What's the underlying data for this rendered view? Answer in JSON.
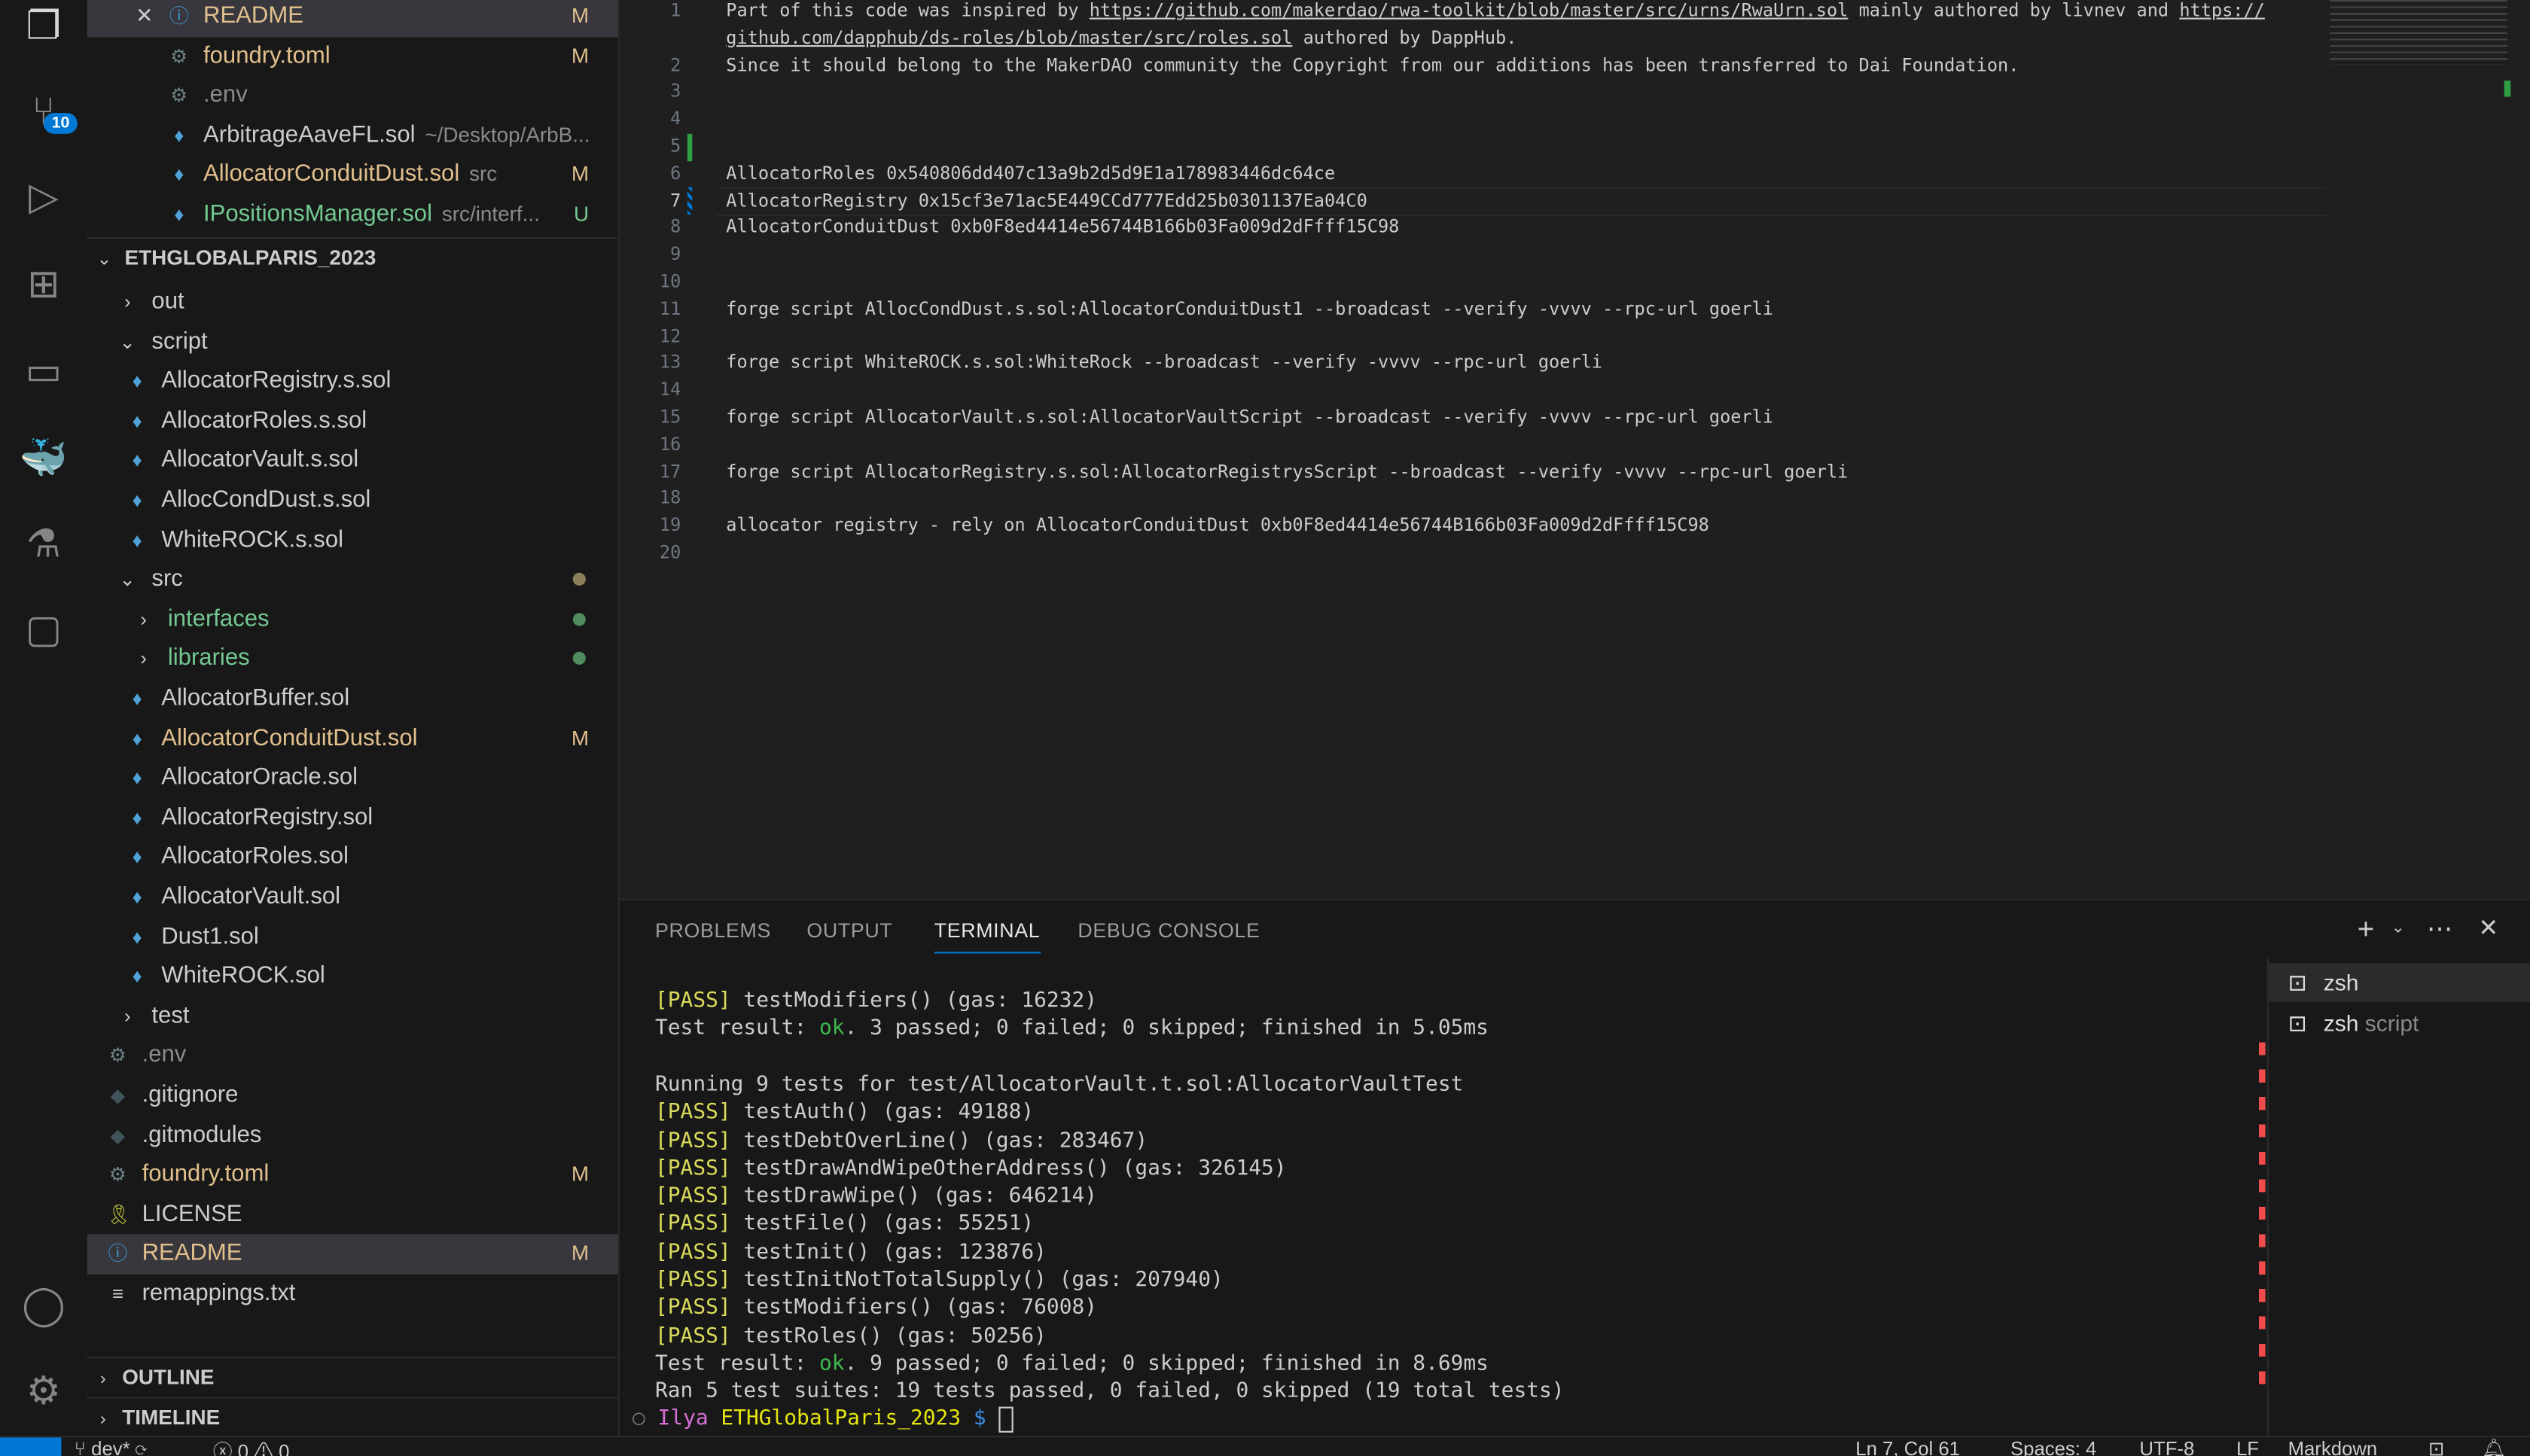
{
  "activity": {
    "source_control_badge": "10",
    "icons": [
      "files-icon",
      "source-control-icon",
      "run-debug-icon",
      "extensions-icon",
      "remote-explorer-icon",
      "docker-icon",
      "testing-icon",
      "comments-icon",
      "account-icon",
      "settings-gear-icon"
    ]
  },
  "open_editors": [
    {
      "label": "README",
      "status": "M",
      "color": "#e2c08d",
      "icon": "info",
      "selected": true,
      "close": true
    },
    {
      "label": "foundry.toml",
      "status": "M",
      "color": "#e2c08d",
      "icon": "gear"
    },
    {
      "label": ".env",
      "status": "",
      "color": "#8b8b8b",
      "icon": "gear"
    },
    {
      "label": "ArbitrageAaveFL.sol",
      "desc": "~/Desktop/ArbB...",
      "status": "",
      "color": "#ccc",
      "icon": "eth"
    },
    {
      "label": "AllocatorConduitDust.sol",
      "desc": "src",
      "status": "M",
      "color": "#e2c08d",
      "icon": "eth"
    },
    {
      "label": "IPositionsManager.sol",
      "desc": "src/interf...",
      "status": "U",
      "color": "#73c991",
      "icon": "eth"
    }
  ],
  "workspace": {
    "title": "ETHGLOBALPARIS_2023",
    "items": [
      {
        "label": "out",
        "level": 1,
        "type": "folder-closed",
        "color": "#ccc"
      },
      {
        "label": "script",
        "level": 1,
        "type": "folder-open",
        "color": "#ccc"
      },
      {
        "label": "AllocatorRegistry.s.sol",
        "level": 2,
        "type": "eth",
        "color": "#ccc"
      },
      {
        "label": "AllocatorRoles.s.sol",
        "level": 2,
        "type": "eth",
        "color": "#ccc"
      },
      {
        "label": "AllocatorVault.s.sol",
        "level": 2,
        "type": "eth",
        "color": "#ccc"
      },
      {
        "label": "AllocCondDust.s.sol",
        "level": 2,
        "type": "eth",
        "color": "#ccc"
      },
      {
        "label": "WhiteROCK.s.sol",
        "level": 2,
        "type": "eth",
        "color": "#ccc"
      },
      {
        "label": "src",
        "level": 1,
        "type": "folder-open",
        "color": "#ccc",
        "dot": "#8b7f5a"
      },
      {
        "label": "interfaces",
        "level": 2,
        "type": "folder-closed",
        "color": "#73c991",
        "dot": "#4e8c5e"
      },
      {
        "label": "libraries",
        "level": 2,
        "type": "folder-closed",
        "color": "#73c991",
        "dot": "#4e8c5e"
      },
      {
        "label": "AllocatorBuffer.sol",
        "level": 2,
        "type": "eth",
        "color": "#ccc"
      },
      {
        "label": "AllocatorConduitDust.sol",
        "level": 2,
        "type": "eth",
        "color": "#e2c08d",
        "status": "M"
      },
      {
        "label": "AllocatorOracle.sol",
        "level": 2,
        "type": "eth",
        "color": "#ccc"
      },
      {
        "label": "AllocatorRegistry.sol",
        "level": 2,
        "type": "eth",
        "color": "#ccc"
      },
      {
        "label": "AllocatorRoles.sol",
        "level": 2,
        "type": "eth",
        "color": "#ccc"
      },
      {
        "label": "AllocatorVault.sol",
        "level": 2,
        "type": "eth",
        "color": "#ccc"
      },
      {
        "label": "Dust1.sol",
        "level": 2,
        "type": "eth",
        "color": "#ccc"
      },
      {
        "label": "WhiteROCK.sol",
        "level": 2,
        "type": "eth",
        "color": "#ccc"
      },
      {
        "label": "test",
        "level": 1,
        "type": "folder-closed",
        "color": "#ccc"
      },
      {
        "label": ".env",
        "level": 1,
        "type": "gear",
        "color": "#8b8b8b"
      },
      {
        "label": ".gitignore",
        "level": 1,
        "type": "git",
        "color": "#ccc"
      },
      {
        "label": ".gitmodules",
        "level": 1,
        "type": "git",
        "color": "#ccc"
      },
      {
        "label": "foundry.toml",
        "level": 1,
        "type": "gear",
        "color": "#e2c08d",
        "status": "M"
      },
      {
        "label": "LICENSE",
        "level": 1,
        "type": "license",
        "color": "#ccc"
      },
      {
        "label": "README",
        "level": 1,
        "type": "info",
        "color": "#e2c08d",
        "status": "M",
        "selected": true
      },
      {
        "label": "remappings.txt",
        "level": 1,
        "type": "lines",
        "color": "#ccc"
      }
    ]
  },
  "outline": "OUTLINE",
  "timeline": "TIMELINE",
  "editor": {
    "lines": [
      {
        "n": "1",
        "parts": [
          {
            "t": "Part of this code was inspired by "
          },
          {
            "t": "https://github.com/makerdao/rwa-toolkit/blob/master/src/urns/RwaUrn.sol",
            "link": true
          },
          {
            "t": " mainly authored by livnev and "
          },
          {
            "t": "https://",
            "link": true
          }
        ]
      },
      {
        "n": "",
        "parts": [
          {
            "t": "github.com/dapphub/ds-roles/blob/master/src/roles.sol",
            "link": true
          },
          {
            "t": " authored by DappHub."
          }
        ]
      },
      {
        "n": "2",
        "parts": [
          {
            "t": "Since it should belong to the MakerDAO community the Copyright from our additions has been transferred to Dai Foundation."
          }
        ]
      },
      {
        "n": "3",
        "parts": []
      },
      {
        "n": "4",
        "parts": []
      },
      {
        "n": "5",
        "parts": []
      },
      {
        "n": "6",
        "parts": [
          {
            "t": "AllocatorRoles 0x540806dd407c13a9b2d5d9E1a178983446dc64ce"
          }
        ]
      },
      {
        "n": "7",
        "parts": [
          {
            "t": "AllocatorRegistry 0x15cf3e71ac5E449CCd777Edd25b0301137Ea04C0"
          }
        ]
      },
      {
        "n": "8",
        "parts": [
          {
            "t": "AllocatorConduitDust 0xb0F8ed4414e56744B166b03Fa009d2dFfff15C98"
          }
        ]
      },
      {
        "n": "9",
        "parts": []
      },
      {
        "n": "10",
        "parts": []
      },
      {
        "n": "11",
        "parts": [
          {
            "t": "forge script AllocCondDust.s.sol:AllocatorConduitDust1 --broadcast --verify -vvvv --rpc-url goerli"
          }
        ]
      },
      {
        "n": "12",
        "parts": []
      },
      {
        "n": "13",
        "parts": [
          {
            "t": "forge script WhiteROCK.s.sol:WhiteRock --broadcast --verify -vvvv --rpc-url goerli"
          }
        ]
      },
      {
        "n": "14",
        "parts": []
      },
      {
        "n": "15",
        "parts": [
          {
            "t": "forge script AllocatorVault.s.sol:AllocatorVaultScript --broadcast --verify -vvvv --rpc-url goerli"
          }
        ]
      },
      {
        "n": "16",
        "parts": []
      },
      {
        "n": "17",
        "parts": [
          {
            "t": "forge script AllocatorRegistry.s.sol:AllocatorRegistrysScript --broadcast --verify -vvvv --rpc-url goerli"
          }
        ]
      },
      {
        "n": "18",
        "parts": []
      },
      {
        "n": "19",
        "parts": [
          {
            "t": "allocator registry - rely on AllocatorConduitDust 0xb0F8ed4414e56744B166b03Fa009d2dFfff15C98"
          }
        ]
      },
      {
        "n": "20",
        "parts": []
      }
    ]
  },
  "panel": {
    "tabs": [
      "PROBLEMS",
      "OUTPUT",
      "TERMINAL",
      "DEBUG CONSOLE"
    ],
    "active": "TERMINAL",
    "terminal_lines": [
      {
        "pass": "[PASS]",
        "t": " testModifiers() (gas: 16232)"
      },
      {
        "pre": "Test result: ",
        "ok": "ok",
        "t": ". 3 passed; 0 failed; 0 skipped; finished in 5.05ms"
      },
      {
        "t": ""
      },
      {
        "t": "Running 9 tests for test/AllocatorVault.t.sol:AllocatorVaultTest"
      },
      {
        "pass": "[PASS]",
        "t": " testAuth() (gas: 49188)"
      },
      {
        "pass": "[PASS]",
        "t": " testDebtOverLine() (gas: 283467)"
      },
      {
        "pass": "[PASS]",
        "t": " testDrawAndWipeOtherAddress() (gas: 326145)"
      },
      {
        "pass": "[PASS]",
        "t": " testDrawWipe() (gas: 646214)"
      },
      {
        "pass": "[PASS]",
        "t": " testFile() (gas: 55251)"
      },
      {
        "pass": "[PASS]",
        "t": " testInit() (gas: 123876)"
      },
      {
        "pass": "[PASS]",
        "t": " testInitNotTotalSupply() (gas: 207940)"
      },
      {
        "pass": "[PASS]",
        "t": " testModifiers() (gas: 76008)"
      },
      {
        "pass": "[PASS]",
        "t": " testRoles() (gas: 50256)"
      },
      {
        "pre": "Test result: ",
        "ok": "ok",
        "t": ". 9 passed; 0 failed; 0 skipped; finished in 8.69ms"
      },
      {
        "t": "Ran 5 test suites: 19 tests passed, 0 failed, 0 skipped (19 total tests)"
      }
    ],
    "prompt": {
      "user": "Ilya",
      "dir": "ETHGlobalParis_2023",
      "symbol": "$"
    },
    "terminals": [
      {
        "name": "zsh",
        "desc": ""
      },
      {
        "name": "zsh",
        "desc": "script"
      }
    ]
  },
  "status": {
    "branch": "dev*",
    "errors": "0",
    "warnings": "0",
    "position": "Ln 7, Col 61",
    "spaces": "Spaces: 4",
    "encoding": "UTF-8",
    "eol": "LF",
    "language": "Markdown"
  }
}
